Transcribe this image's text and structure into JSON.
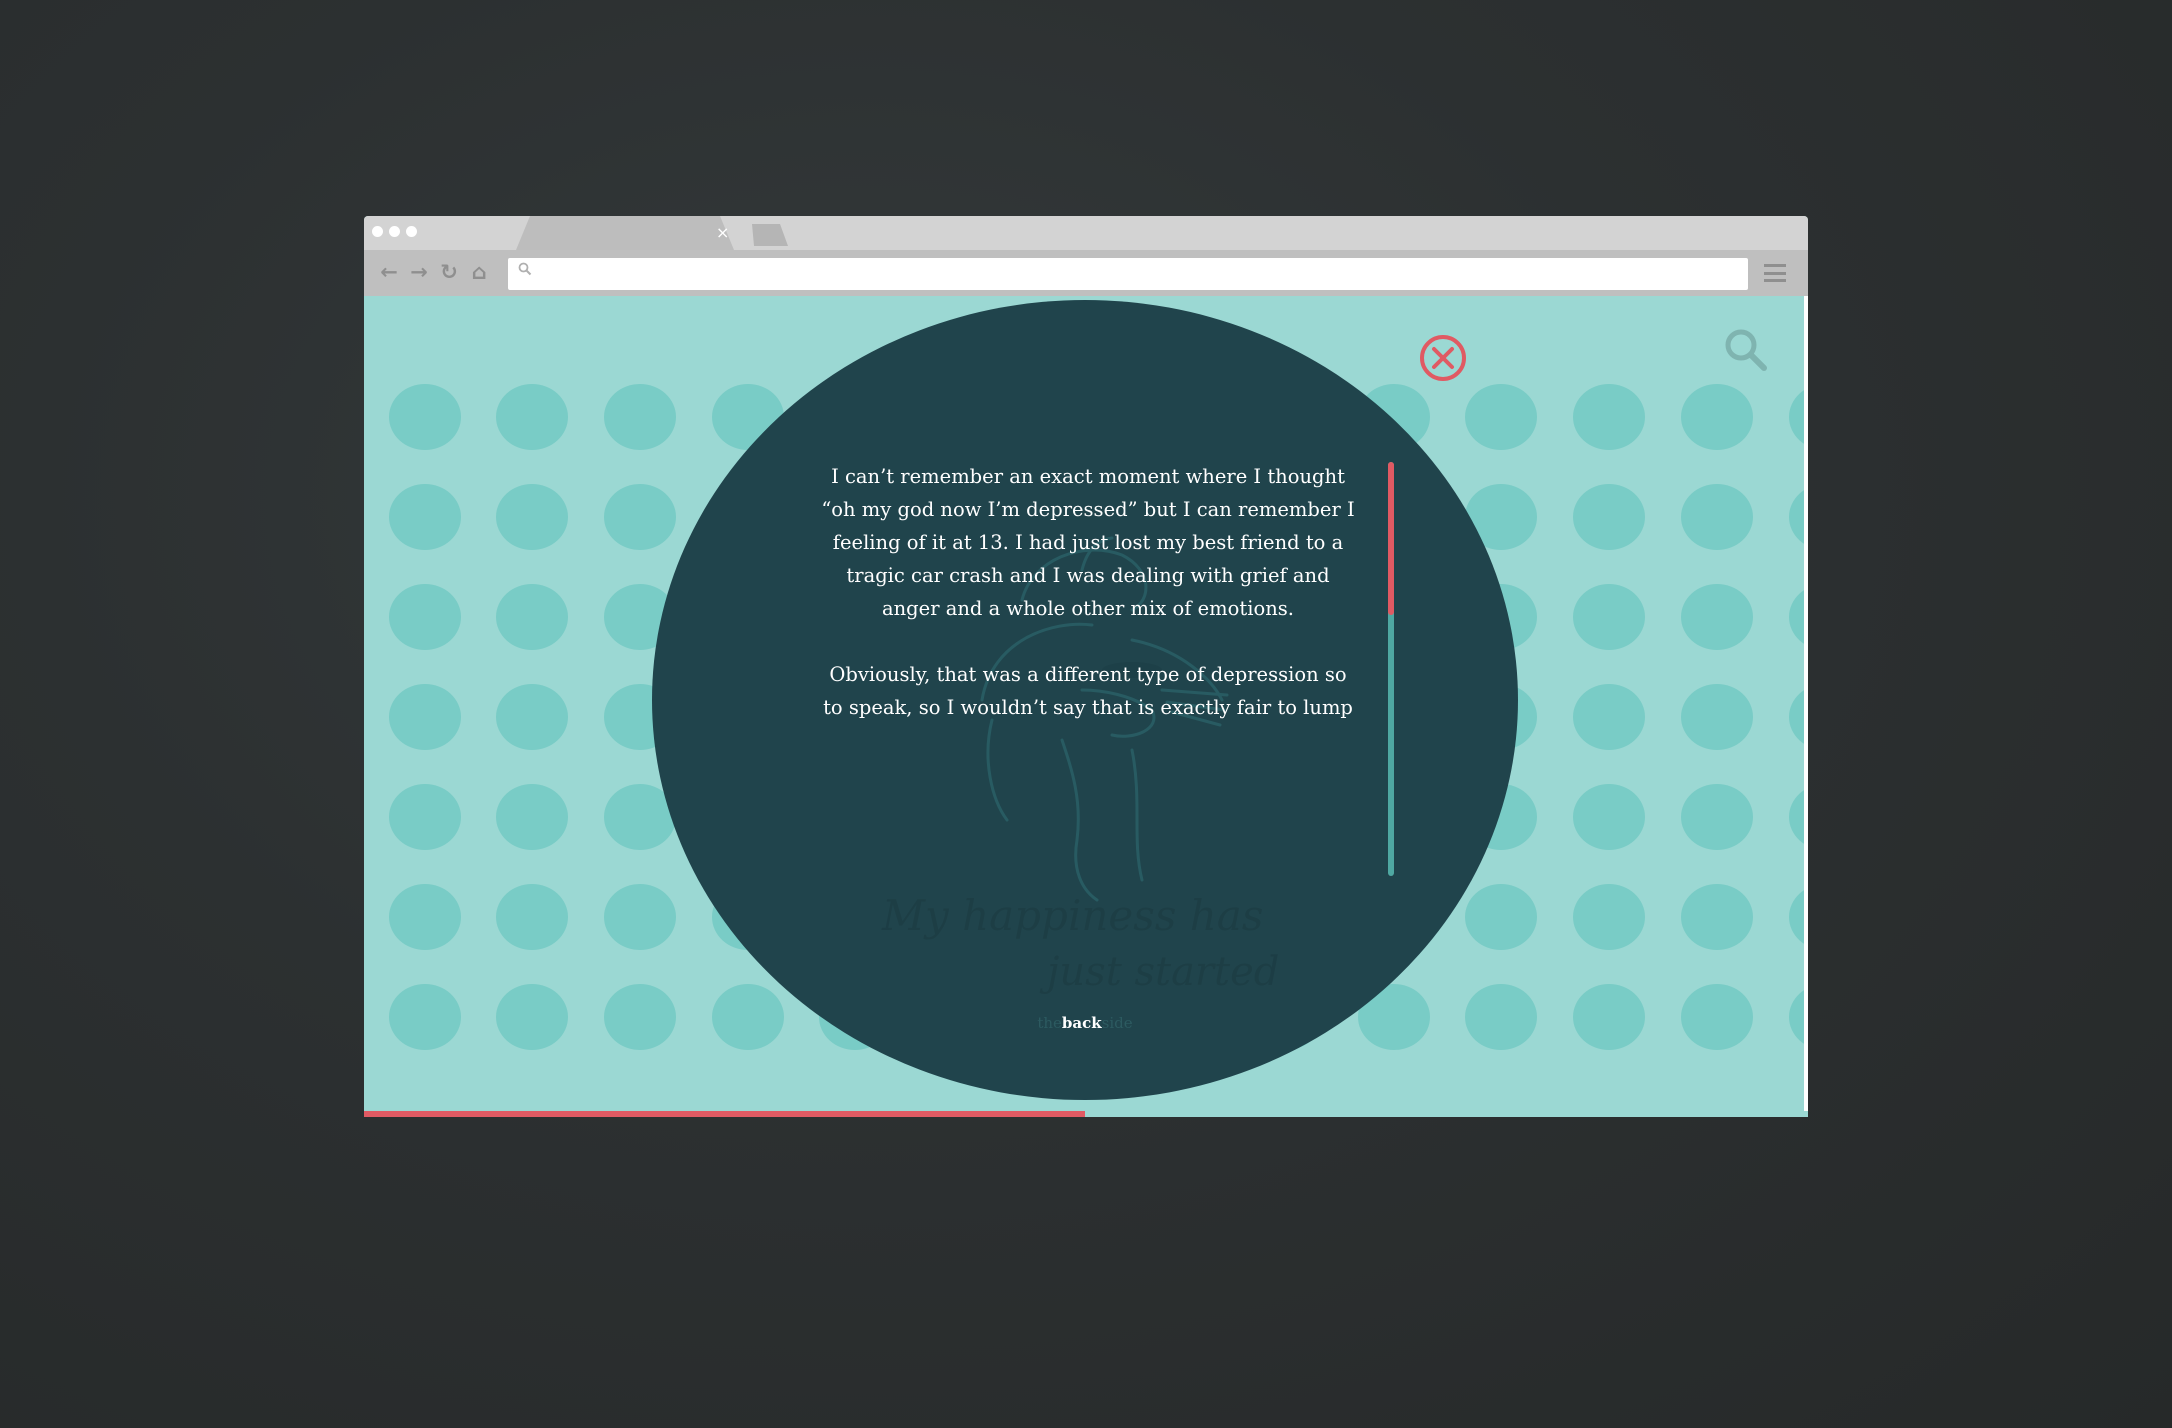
{
  "browser": {
    "tab_close_glyph": "×",
    "nav": {
      "back_glyph": "←",
      "forward_glyph": "→",
      "reload_glyph": "↻",
      "home_glyph": "⌂"
    },
    "address_value": ""
  },
  "page": {
    "story_paragraphs": [
      "I can’t remember an exact moment where I thought “oh my god now I’m depressed” but I can remember I feeling of it at 13. I had just lost my best friend to a tragic car crash and I was dealing with grief and anger and a whole other mix of emotions.",
      "Obviously, that was a different type of depression so to speak, so I wouldn’t say that is exactly fair to lump together. But I definitely found out how it feels to not really care much about life during that year and that feeling is extremely close to what I feel sometimes when I fall in to a deeper depression. So I got a glimpse of it young for sure."
    ],
    "handwriting_line1": "My happiness has",
    "handwriting_line2": "just started",
    "back_label": "back",
    "back_ghost_left": "the",
    "back_ghost_right": "side",
    "text_scroll_position": 0.26,
    "reading_progress": 0.5
  },
  "icons": {
    "close": "close-circle-icon",
    "search": "search-icon",
    "menu": "hamburger-menu-icon"
  },
  "colors": {
    "background": "#2c3031",
    "page_bg": "#9bd8d3",
    "dot": "#79ccc6",
    "circle": "#20444c",
    "accent": "#e05a63",
    "scroll_track": "#4fa8a2"
  }
}
